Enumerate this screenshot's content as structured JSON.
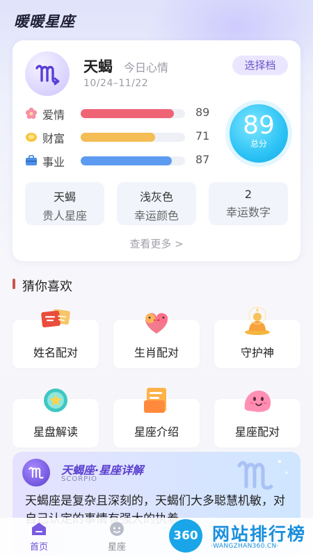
{
  "app": {
    "title": "暖暖星座"
  },
  "horoscope": {
    "sign_name": "天蝎",
    "mood_label": "今日心情",
    "date_range": "10/24–11/22",
    "select_button": "选择档",
    "stats": [
      {
        "label": "爱情",
        "value": 89,
        "color": "#ef6475",
        "icon": "flower-icon"
      },
      {
        "label": "财富",
        "value": 71,
        "color": "#f4bd55",
        "icon": "coin-icon"
      },
      {
        "label": "事业",
        "value": 87,
        "color": "#5c9bf0",
        "icon": "briefcase-icon"
      }
    ],
    "score": {
      "value": "89",
      "label": "总分"
    },
    "info": [
      {
        "value": "天蝎",
        "key": "贵人星座"
      },
      {
        "value": "浅灰色",
        "key": "幸运颜色"
      },
      {
        "value": "2",
        "key": "幸运数字"
      }
    ],
    "see_more": "查看更多 >"
  },
  "guess": {
    "title": "猜你喜欢",
    "items": [
      {
        "label": "姓名配对",
        "icon": "name-card-icon"
      },
      {
        "label": "生肖配对",
        "icon": "birds-icon"
      },
      {
        "label": "守护神",
        "icon": "buddha-icon"
      },
      {
        "label": "星盘解读",
        "icon": "star-plate-icon"
      },
      {
        "label": "星座介绍",
        "icon": "folder-icon"
      },
      {
        "label": "星座配对",
        "icon": "blob-icon"
      }
    ]
  },
  "banner": {
    "title": "天蝎座·星座详解",
    "subtitle": "SCORPIO",
    "text": "天蝎座是复杂且深刻的，天蝎们大多聪慧机敏，对自己认定的事情有强大的执着"
  },
  "nav": {
    "items": [
      {
        "label": "首页",
        "active": true,
        "icon": "home-icon"
      },
      {
        "label": "星座",
        "active": false,
        "icon": "face-icon"
      }
    ]
  },
  "watermark": {
    "logo": "360",
    "text": "网站排行榜",
    "url": "·WANGZHAN360.CN·"
  },
  "colors": {
    "accent": "#6a55c8",
    "score": "#2cc3f5",
    "section_bar": "#c6564a"
  }
}
